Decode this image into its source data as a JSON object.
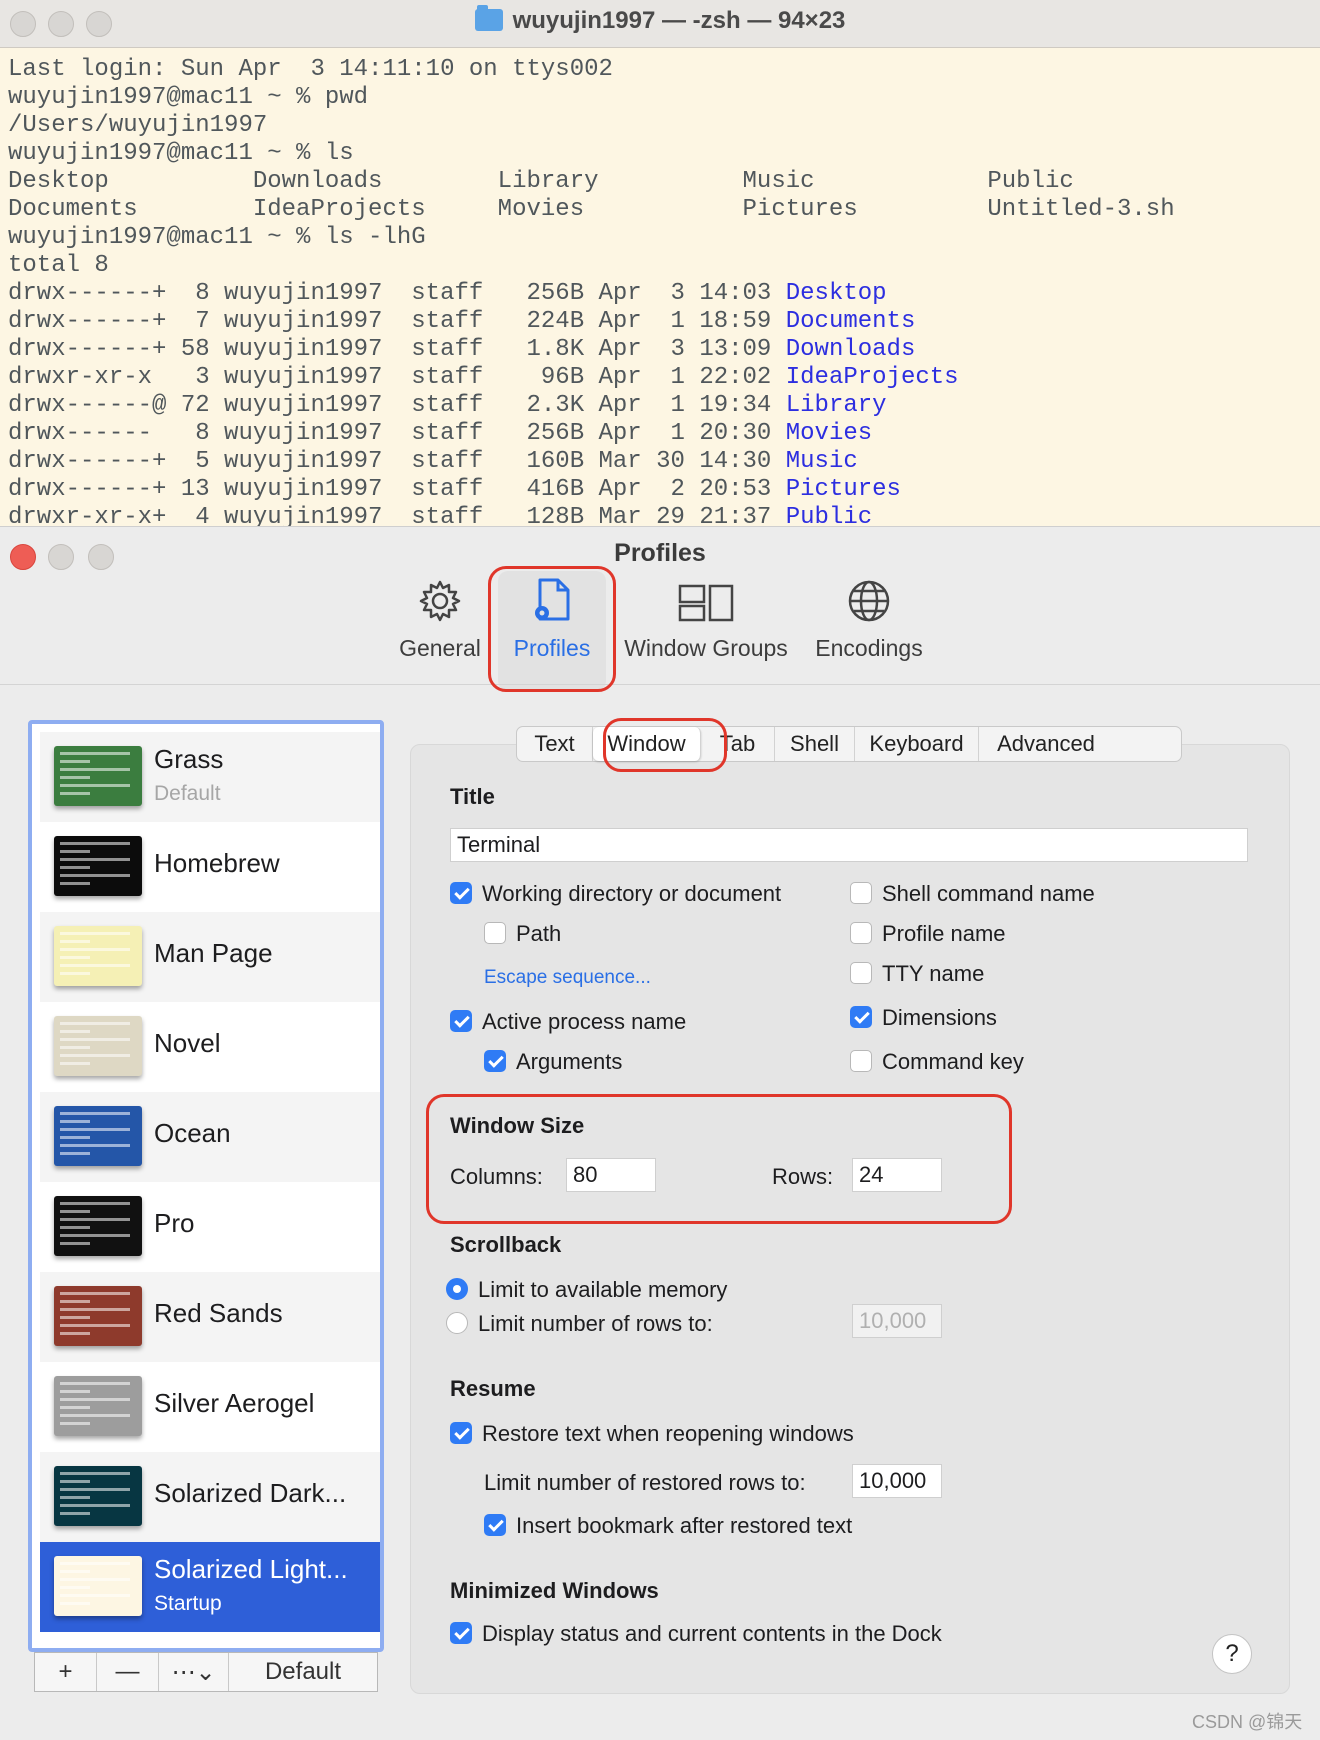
{
  "terminal": {
    "title": "wuyujin1997 — -zsh — 94×23",
    "lines": [
      {
        "text": "Last login: Sun Apr  3 14:11:10 on ttys002"
      },
      {
        "text": "wuyujin1997@mac11 ~ % pwd"
      },
      {
        "text": "/Users/wuyujin1997"
      },
      {
        "text": "wuyujin1997@mac11 ~ % ls"
      },
      {
        "text": "Desktop          Downloads        Library          Music            Public"
      },
      {
        "text": "Documents        IdeaProjects     Movies           Pictures         Untitled-3.sh"
      },
      {
        "text": "wuyujin1997@mac11 ~ % ls -lhG"
      },
      {
        "text": "total 8"
      },
      {
        "text": "drwx------+  8 wuyujin1997  staff   256B Apr  3 14:03 ",
        "dir": "Desktop"
      },
      {
        "text": "drwx------+  7 wuyujin1997  staff   224B Apr  1 18:59 ",
        "dir": "Documents"
      },
      {
        "text": "drwx------+ 58 wuyujin1997  staff   1.8K Apr  3 13:09 ",
        "dir": "Downloads"
      },
      {
        "text": "drwxr-xr-x   3 wuyujin1997  staff    96B Apr  1 22:02 ",
        "dir": "IdeaProjects"
      },
      {
        "text": "drwx------@ 72 wuyujin1997  staff   2.3K Apr  1 19:34 ",
        "dir": "Library"
      },
      {
        "text": "drwx------   8 wuyujin1997  staff   256B Apr  1 20:30 ",
        "dir": "Movies"
      },
      {
        "text": "drwx------+  5 wuyujin1997  staff   160B Mar 30 14:30 ",
        "dir": "Music"
      },
      {
        "text": "drwx------+ 13 wuyujin1997  staff   416B Apr  2 20:53 ",
        "dir": "Pictures"
      },
      {
        "text": "drwxr-xr-x+  4 wuyujin1997  staff   128B Mar 29 21:37 ",
        "dir": "Public"
      }
    ]
  },
  "prefs": {
    "title": "Profiles",
    "toolbar": {
      "general": "General",
      "profiles": "Profiles",
      "window_groups": "Window Groups",
      "encodings": "Encodings"
    },
    "profiles": [
      {
        "name": "Grass",
        "sub": "Default",
        "color": "#3b7d3f"
      },
      {
        "name": "Homebrew",
        "sub": "",
        "color": "#0c0c0c"
      },
      {
        "name": "Man Page",
        "sub": "",
        "color": "#f5f0b5"
      },
      {
        "name": "Novel",
        "sub": "",
        "color": "#ded8c4"
      },
      {
        "name": "Ocean",
        "sub": "",
        "color": "#2456a8"
      },
      {
        "name": "Pro",
        "sub": "",
        "color": "#111111"
      },
      {
        "name": "Red Sands",
        "sub": "",
        "color": "#8e3a2c"
      },
      {
        "name": "Silver Aerogel",
        "sub": "",
        "color": "#9d9d9d"
      },
      {
        "name": "Solarized Dark...",
        "sub": "",
        "color": "#073642"
      },
      {
        "name": "Solarized Light...",
        "sub": "Startup",
        "color": "#fdf6e3"
      }
    ],
    "list_buttons": {
      "add": "+",
      "remove": "—",
      "more": "⋯⌄",
      "default": "Default"
    },
    "tabs": [
      "Text",
      "Window",
      "Tab",
      "Shell",
      "Keyboard",
      "Advanced"
    ],
    "title_section": {
      "heading": "Title",
      "value": "Terminal",
      "working_dir": "Working directory or document",
      "path": "Path",
      "escape": "Escape sequence...",
      "active_process": "Active process name",
      "arguments": "Arguments",
      "shell_command": "Shell command name",
      "profile_name": "Profile name",
      "tty_name": "TTY name",
      "dimensions": "Dimensions",
      "command_key": "Command key"
    },
    "window_size": {
      "heading": "Window Size",
      "columns_label": "Columns:",
      "columns": "80",
      "rows_label": "Rows:",
      "rows": "24"
    },
    "scrollback": {
      "heading": "Scrollback",
      "limit_memory": "Limit to available memory",
      "limit_rows": "Limit number of rows to:",
      "rows_value": "10,000"
    },
    "resume": {
      "heading": "Resume",
      "restore": "Restore text when reopening windows",
      "limit_restored": "Limit number of restored rows to:",
      "restored_value": "10,000",
      "bookmark": "Insert bookmark after restored text"
    },
    "minimized": {
      "heading": "Minimized Windows",
      "display": "Display status and current contents in the Dock"
    },
    "help": "?"
  },
  "watermark": "CSDN @锦天",
  "colors": {
    "accent": "#2f7bf5",
    "highlight_red": "#e0362a",
    "selection": "#2e5fd8",
    "terminal_bg": "#fdf6e3",
    "dir_blue": "#2c2ee0"
  }
}
